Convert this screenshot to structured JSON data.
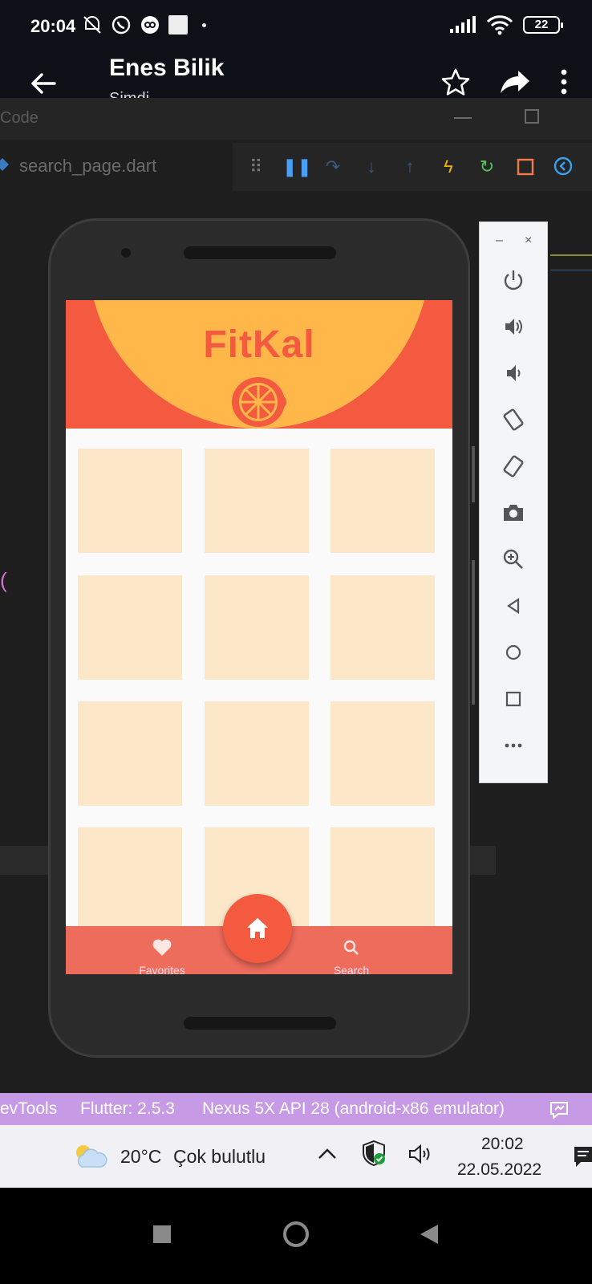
{
  "status_bar": {
    "time": "20:04",
    "battery": "22",
    "icons": [
      "mute-icon",
      "whatsapp-icon",
      "link-icon",
      "square-icon",
      "signal-icon",
      "wifi-icon",
      "battery-icon"
    ]
  },
  "chat": {
    "name": "Enes Bilik",
    "subtitle": "Şimdi",
    "actions": [
      "star-icon",
      "share-icon",
      "more-vert-icon"
    ]
  },
  "vscode": {
    "title_fragment": "Code",
    "tab_label": "search_page.dart",
    "bracket": "(",
    "status": {
      "devtools": "evTools",
      "flutter": "Flutter: 2.5.3",
      "device": "Nexus 5X API 28 (android-x86 emulator)"
    }
  },
  "app": {
    "title": "FitKal",
    "tile_count": 12,
    "nav": {
      "left_label": "Favorites",
      "right_label": "Search"
    },
    "colors": {
      "primary": "#f45a40",
      "accent": "#ffb74a",
      "tile": "#fce8c8",
      "nav": "#ee6c5c"
    }
  },
  "emulator_toolbar": {
    "top_min": "–",
    "top_close": "×",
    "buttons": [
      "power-icon",
      "volume-up-icon",
      "volume-down-icon",
      "rotate-left-icon",
      "rotate-right-icon",
      "camera-icon",
      "zoom-icon",
      "back-icon",
      "home-icon",
      "overview-icon",
      "more-icon"
    ]
  },
  "taskbar": {
    "temperature": "20°C",
    "weather": "Çok bulutlu",
    "clock_time": "20:02",
    "clock_date": "22.05.2022"
  }
}
